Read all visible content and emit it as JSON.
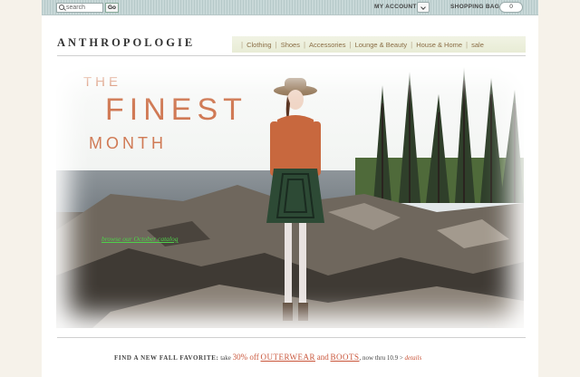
{
  "search": {
    "placeholder": "search",
    "go_label": "Go"
  },
  "utility": {
    "my_account": "MY ACCOUNT",
    "shopping_bag": "SHOPPING BAG",
    "bag_count": "0"
  },
  "brand": {
    "logo": "ANTHROPOLOGIE"
  },
  "nav": {
    "items": [
      "Clothing",
      "Shoes",
      "Accessories",
      "Lounge & Beauty",
      "House & Home",
      "sale"
    ]
  },
  "hero": {
    "line1": "THE",
    "line2": "FINEST",
    "line3": "MONTH",
    "catalog_link": "browse our October catalog"
  },
  "promo": {
    "lead": "FIND A NEW FALL FAVORITE:",
    "take": "take",
    "percent": "30% off",
    "cat1": "OUTERWEAR",
    "and": "and",
    "cat2": "BOOTS",
    "tail": ", now thru 10.9 >",
    "details": "details"
  },
  "colors": {
    "accent": "#d07a55",
    "link_green": "#4fd14a",
    "nav_text": "#8a6d45"
  }
}
